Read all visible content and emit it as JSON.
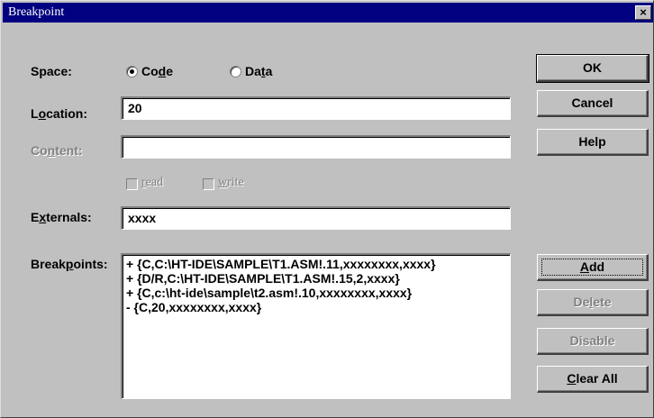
{
  "window": {
    "title": "Breakpoint",
    "close_glyph": "×"
  },
  "space": {
    "label_pre": "Space:",
    "options": [
      {
        "pre": "Co",
        "accel": "d",
        "post": "e",
        "selected": true
      },
      {
        "pre": "Da",
        "accel": "t",
        "post": "a",
        "selected": false
      }
    ]
  },
  "location": {
    "label_pre": "L",
    "label_accel": "o",
    "label_post": "cation:",
    "value": "20"
  },
  "content": {
    "label_pre": "Co",
    "label_accel": "n",
    "label_post": "tent:",
    "value": "",
    "enabled": false
  },
  "access": [
    {
      "accel": "r",
      "post": "ead",
      "checked": false,
      "enabled": false
    },
    {
      "accel": "w",
      "post": "rite",
      "checked": false,
      "enabled": false
    }
  ],
  "externals": {
    "label_pre": "E",
    "label_accel": "x",
    "label_post": "ternals:",
    "value": "xxxx"
  },
  "breakpoints": {
    "label_pre": "Break",
    "label_accel": "p",
    "label_post": "oints:",
    "items": [
      "+ {C,C:\\HT-IDE\\SAMPLE\\T1.ASM!.11,xxxxxxxx,xxxx}",
      "+ {D/R,C:\\HT-IDE\\SAMPLE\\T1.ASM!.15,2,xxxx}",
      "+ {C,c:\\ht-ide\\sample\\t2.asm!.10,xxxxxxxx,xxxx}",
      "- {C,20,xxxxxxxx,xxxx}"
    ]
  },
  "buttons": {
    "ok": "OK",
    "cancel": "Cancel",
    "help": "Help",
    "add": {
      "accel": "A",
      "post": "dd"
    },
    "delete": {
      "pre": "De",
      "accel": "l",
      "post": "ete"
    },
    "disable": "Disable",
    "clear_all": {
      "accel": "C",
      "post": "lear All"
    }
  }
}
